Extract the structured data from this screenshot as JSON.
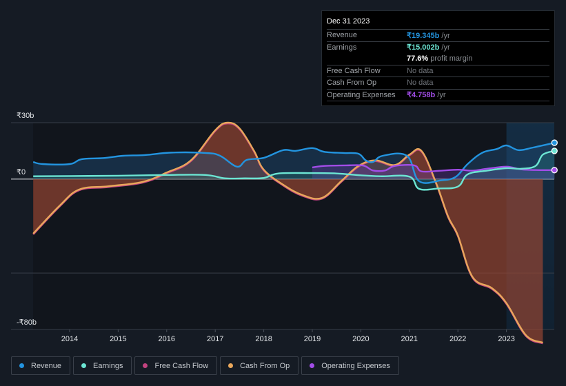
{
  "tooltip": {
    "date": "Dec 31 2023",
    "rows": [
      {
        "label": "Revenue",
        "value": "₹19.345b",
        "unit": " /yr",
        "color": "#2394df"
      },
      {
        "label": "Earnings",
        "value": "₹15.002b",
        "unit": " /yr",
        "color": "#6ce5d3"
      },
      {
        "label": "",
        "value": "77.6%",
        "unit": " profit margin",
        "color": "#ffffff"
      },
      {
        "label": "Free Cash Flow",
        "value": "",
        "unit": "No data",
        "color": "#8a8e93"
      },
      {
        "label": "Cash From Op",
        "value": "",
        "unit": "No data",
        "color": "#8a8e93"
      },
      {
        "label": "Operating Expenses",
        "value": "₹4.758b",
        "unit": " /yr",
        "color": "#a24de8"
      }
    ]
  },
  "legend": [
    {
      "label": "Revenue",
      "color": "#2394df"
    },
    {
      "label": "Earnings",
      "color": "#6ce5d3"
    },
    {
      "label": "Free Cash Flow",
      "color": "#c2437f"
    },
    {
      "label": "Cash From Op",
      "color": "#e9a75b"
    },
    {
      "label": "Operating Expenses",
      "color": "#a24de8"
    }
  ],
  "chart_data": {
    "type": "area",
    "title": "",
    "xlabel": "",
    "ylabel": "",
    "currency": "₹",
    "unit": "b",
    "ylim": [
      -80,
      30
    ],
    "xlim": [
      2013.25,
      2024.0
    ],
    "y_ticks": [
      {
        "value": 30,
        "label": "₹30b"
      },
      {
        "value": 0,
        "label": "₹0"
      },
      {
        "value": -80,
        "label": "-₹80b"
      }
    ],
    "y_gridlines": [
      30,
      0,
      -50,
      -80
    ],
    "x_ticks": [
      "2014",
      "2015",
      "2016",
      "2017",
      "2018",
      "2019",
      "2020",
      "2021",
      "2022",
      "2023"
    ],
    "highlight_range": [
      2023.0,
      2024.0
    ],
    "grid": true,
    "legend_position": "bottom-left",
    "series": [
      {
        "name": "Revenue",
        "color": "#2394df",
        "x": [
          2013.25,
          2013.45,
          2014.0,
          2014.25,
          2014.7,
          2015.1,
          2015.55,
          2016.1,
          2016.8,
          2017.1,
          2017.45,
          2017.65,
          2018.0,
          2018.4,
          2018.65,
          2019.0,
          2019.25,
          2019.65,
          2019.95,
          2020.1,
          2020.25,
          2020.45,
          2020.95,
          2021.2,
          2021.65,
          2021.95,
          2022.2,
          2022.5,
          2022.8,
          2023.0,
          2023.25,
          2023.55,
          2023.99
        ],
        "values": [
          9.1,
          8.0,
          8.0,
          10.6,
          11.2,
          12.4,
          12.8,
          14.1,
          13.9,
          12.4,
          6.6,
          10.2,
          11.3,
          15.4,
          15.0,
          16.5,
          14.5,
          13.9,
          13.5,
          10.0,
          9.1,
          12.4,
          12.4,
          -1.1,
          -0.7,
          1.1,
          8.0,
          14.0,
          16.0,
          17.9,
          15.4,
          16.8,
          19.35
        ]
      },
      {
        "name": "Earnings",
        "color": "#6ce5d3",
        "x": [
          2013.25,
          2014.0,
          2015.0,
          2016.0,
          2016.8,
          2017.2,
          2017.6,
          2018.0,
          2018.3,
          2019.0,
          2019.5,
          2020.0,
          2020.4,
          2021.0,
          2021.2,
          2021.6,
          2022.0,
          2022.2,
          2022.6,
          2023.0,
          2023.3,
          2023.6,
          2023.75,
          2023.99
        ],
        "values": [
          1.5,
          1.6,
          1.8,
          2.2,
          2.2,
          0.4,
          0.4,
          0.6,
          3.0,
          3.2,
          3.0,
          2.0,
          1.5,
          1.3,
          -5.2,
          -5.0,
          -4.0,
          2.5,
          4.5,
          5.8,
          5.5,
          7.0,
          13.0,
          15.0
        ]
      },
      {
        "name": "Free Cash Flow",
        "color": "#c2437f",
        "x": [
          2013.25,
          2013.8,
          2014.2,
          2014.8,
          2015.5,
          2016.0,
          2016.5,
          2017.0,
          2017.25,
          2017.5,
          2017.8,
          2018.0,
          2018.4,
          2018.8,
          2019.2,
          2019.6,
          2019.95,
          2020.3,
          2020.7,
          2021.0,
          2021.25,
          2021.55,
          2021.8,
          2022.0,
          2022.3,
          2022.7,
          2023.0,
          2023.4,
          2023.75
        ],
        "values": [
          -29,
          -14,
          -5.5,
          -3.8,
          -1.5,
          3.5,
          10,
          26,
          30,
          27,
          15,
          5,
          -3,
          -8.5,
          -10,
          -1,
          7,
          10,
          7.5,
          13,
          15,
          -2,
          -20,
          -30,
          -52,
          -58,
          -66,
          -83,
          -87
        ]
      },
      {
        "name": "Cash From Op",
        "color": "#e9a75b",
        "x": [
          2013.25,
          2013.8,
          2014.2,
          2014.8,
          2015.5,
          2016.0,
          2016.5,
          2017.0,
          2017.25,
          2017.5,
          2017.8,
          2018.0,
          2018.4,
          2018.8,
          2019.2,
          2019.6,
          2019.95,
          2020.3,
          2020.7,
          2021.0,
          2021.25,
          2021.55,
          2021.8,
          2022.0,
          2022.3,
          2022.7,
          2023.0,
          2023.4,
          2023.75
        ],
        "values": [
          -29,
          -14,
          -5.5,
          -3.8,
          -1.5,
          3.5,
          10,
          26,
          30,
          27,
          15,
          5,
          -3,
          -8.5,
          -10,
          -1,
          7,
          10,
          7.5,
          13,
          15,
          -2,
          -20,
          -30,
          -52,
          -58,
          -66,
          -83,
          -87
        ]
      },
      {
        "name": "Operating Expenses",
        "color": "#a24de8",
        "x": [
          2019.0,
          2019.25,
          2019.7,
          2020.05,
          2020.25,
          2020.5,
          2020.7,
          2021.1,
          2021.25,
          2021.6,
          2022.0,
          2022.3,
          2022.6,
          2023.0,
          2023.3,
          2023.6,
          2023.99
        ],
        "values": [
          6.2,
          7.0,
          7.3,
          7.2,
          4.6,
          4.6,
          7.0,
          7.3,
          4.1,
          4.4,
          5.0,
          4.5,
          5.5,
          6.6,
          5.2,
          4.8,
          4.76
        ]
      }
    ]
  }
}
